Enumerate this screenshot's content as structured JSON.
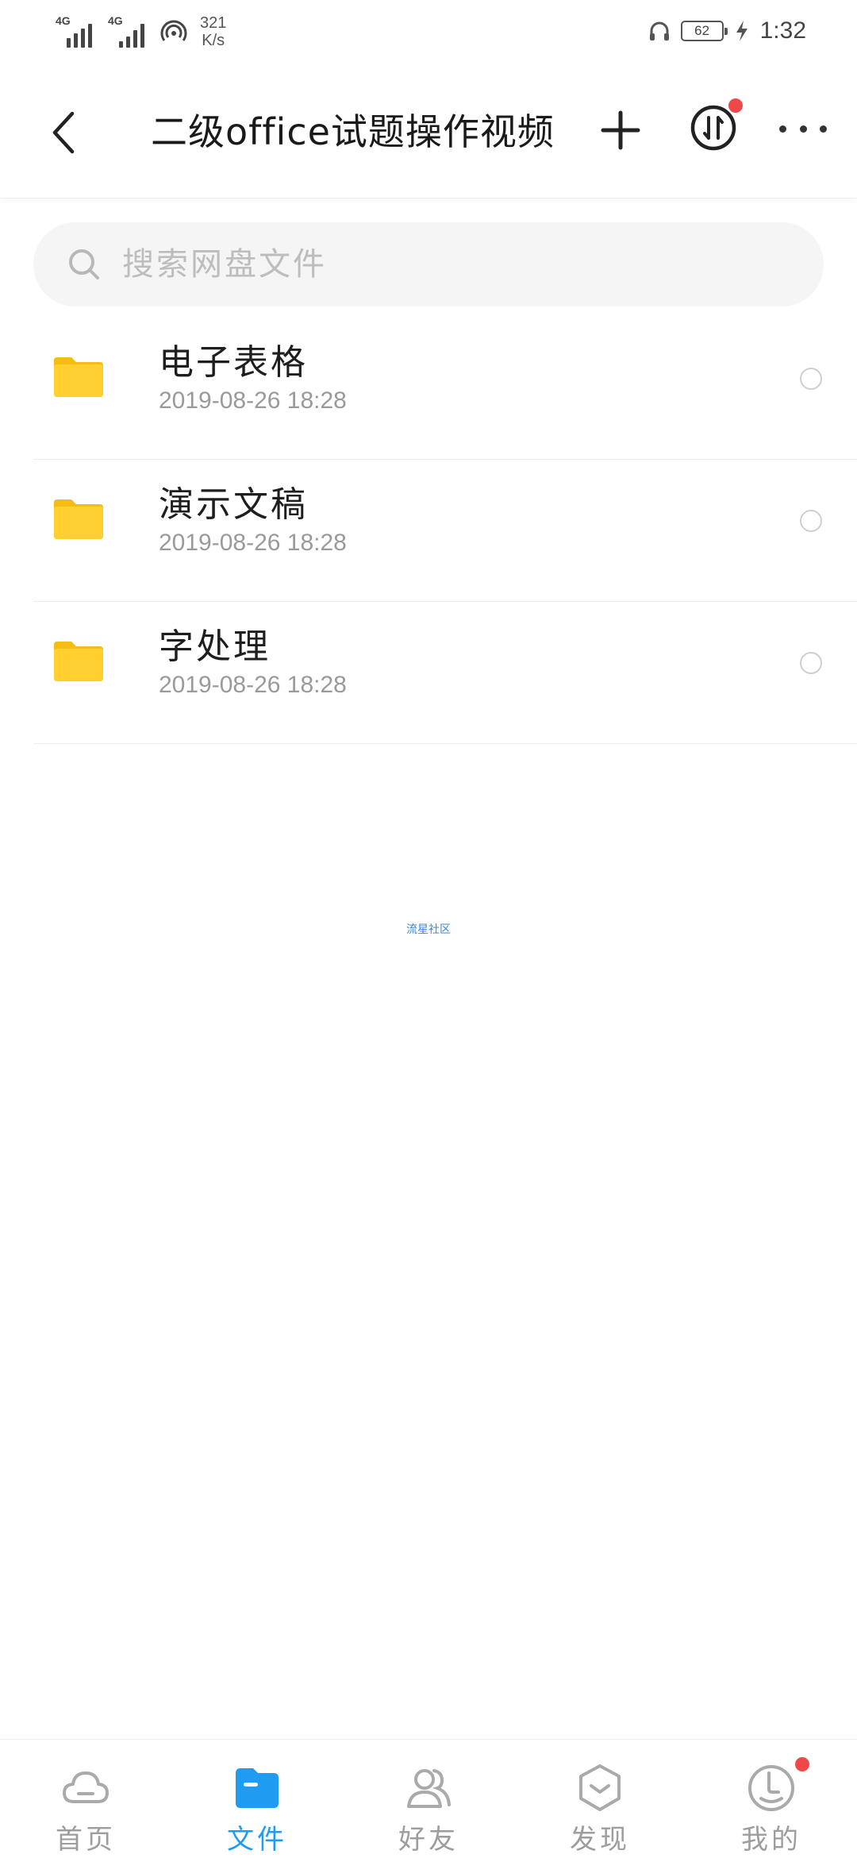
{
  "status_bar": {
    "network_1": "4G",
    "network_2": "4G",
    "speed_value": "321",
    "speed_unit": "K/s",
    "battery": "62",
    "time": "1:32"
  },
  "header": {
    "title": "二级office试题操作视频"
  },
  "search": {
    "placeholder": "搜索网盘文件"
  },
  "files": [
    {
      "name": "电子表格",
      "date": "2019-08-26  18:28"
    },
    {
      "name": "演示文稿",
      "date": "2019-08-26  18:28"
    },
    {
      "name": "字处理",
      "date": "2019-08-26  18:28"
    }
  ],
  "watermark": "流星社区",
  "nav": {
    "home": "首页",
    "files": "文件",
    "friends": "好友",
    "discover": "发现",
    "mine": "我的"
  },
  "colors": {
    "accent": "#1f9bf2",
    "folder": "#ffd02f",
    "badge": "#f04848"
  }
}
